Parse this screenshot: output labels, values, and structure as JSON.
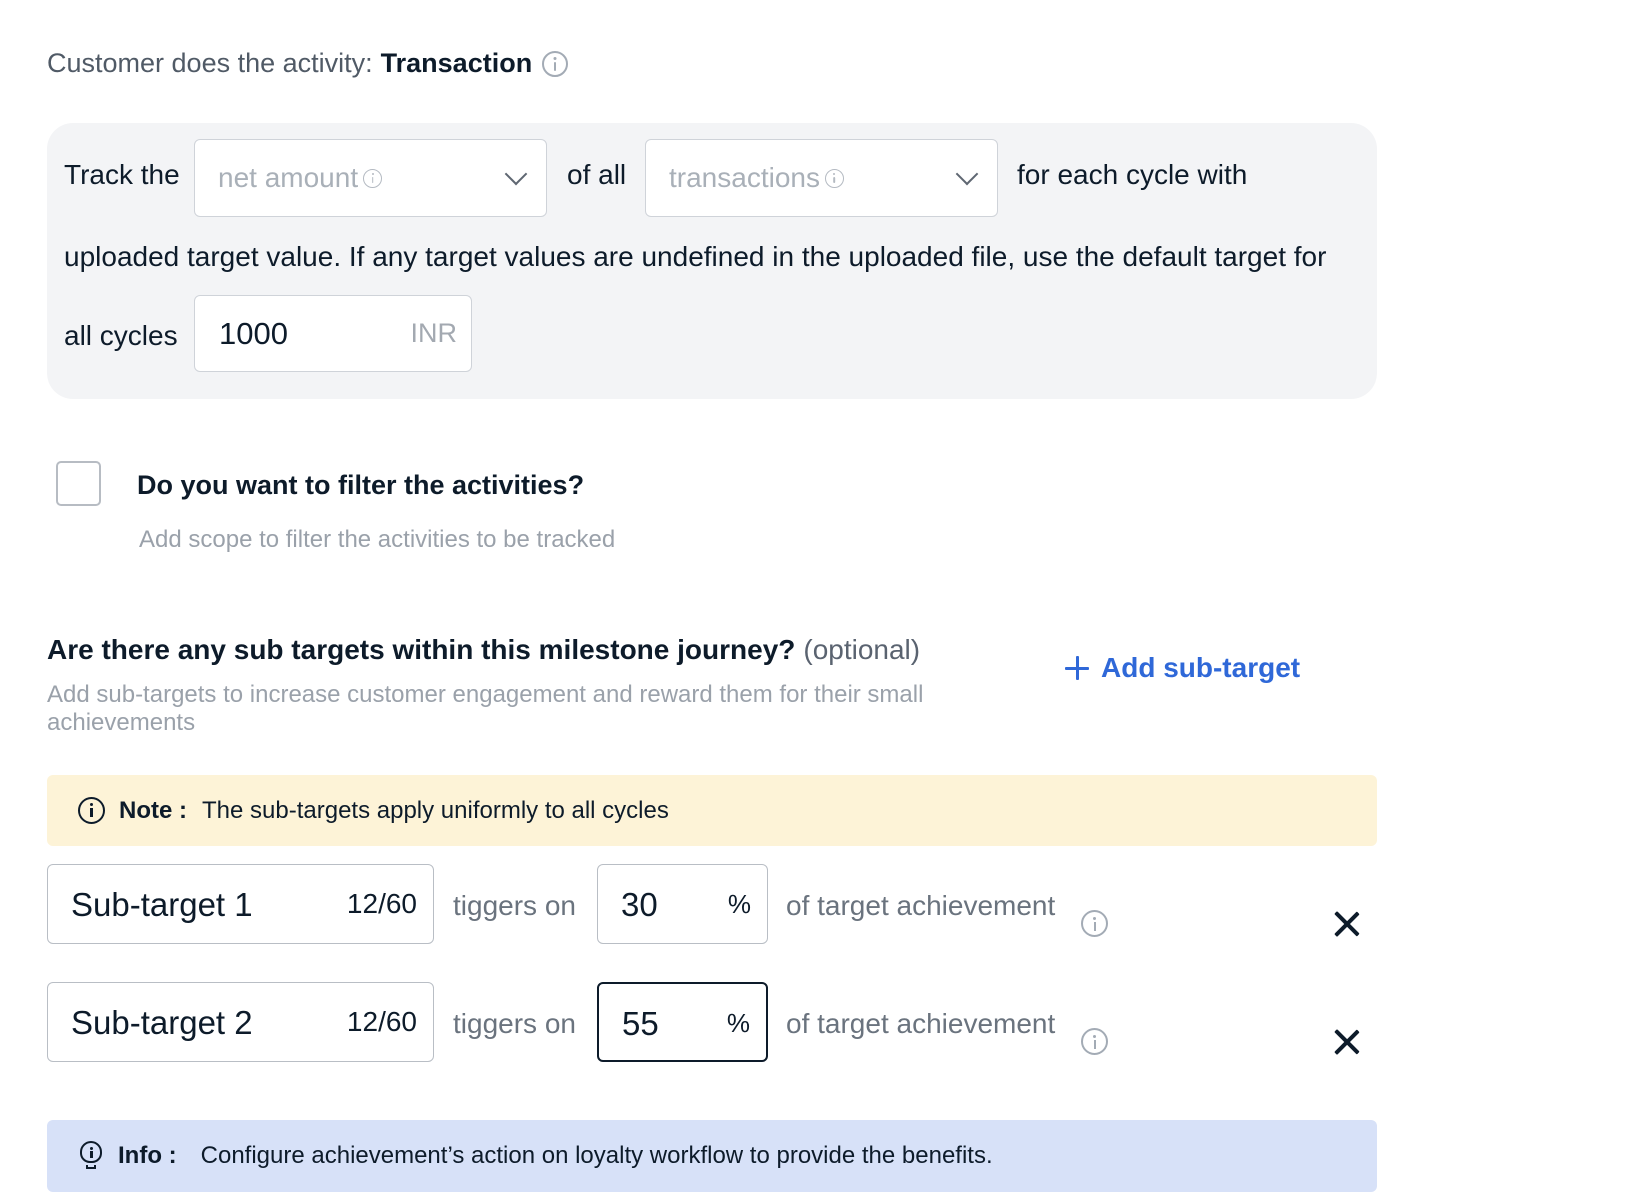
{
  "activity": {
    "prefix": "Customer does the activity:",
    "value": "Transaction",
    "info_icon": "info-circle-icon"
  },
  "tracking": {
    "track_the": "Track the",
    "metric_select": {
      "placeholder": "net amount",
      "icon": "chevron-down-icon"
    },
    "of_all": "of all",
    "entity_select": {
      "placeholder": "transactions",
      "icon": "chevron-down-icon"
    },
    "for_each_cycle": "for each cycle with",
    "uploaded_sentence": "uploaded target value. If any target values are undefined in the uploaded file, use the default target for",
    "all_cycles": "all cycles",
    "default_target": {
      "value": "1000",
      "unit": "INR"
    }
  },
  "filter": {
    "checked": false,
    "question": "Do you want to filter the activities?",
    "help": "Add scope to filter the activities to be tracked"
  },
  "sub_targets": {
    "question": "Are there any sub targets within this milestone journey?",
    "optional": "(optional)",
    "help": "Add sub-targets to increase customer engagement and reward them for their small achievements",
    "add_label": "Add sub-target",
    "note_label": "Note :",
    "note_text": "The sub-targets apply uniformly to all cycles",
    "items": [
      {
        "name": "Sub-target 1",
        "count": "12/60",
        "triggers": "tiggers on",
        "percent": "30",
        "percent_sign": "%",
        "suffix": "of target achievement"
      },
      {
        "name": "Sub-target 2",
        "count": "12/60",
        "triggers": "tiggers on",
        "percent": "55",
        "percent_sign": "%",
        "suffix": "of target achievement"
      }
    ]
  },
  "info": {
    "label": "Info :",
    "text": "Configure achievement’s action on loyalty workflow to provide the benefits.",
    "icon": "lightbulb-icon"
  },
  "colors": {
    "accent": "#2f68d8",
    "note_bg": "#fdf3d7",
    "info_bg": "#d7e1f8",
    "track_bg": "#f3f4f6"
  }
}
